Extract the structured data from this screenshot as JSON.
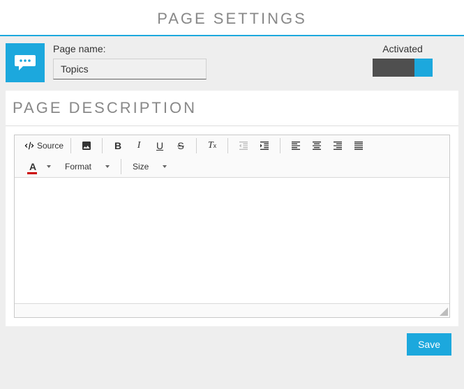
{
  "header": {
    "title": "PAGE SETTINGS"
  },
  "settings": {
    "page_name_label": "Page name:",
    "page_name_value": "Topics",
    "activated_label": "Activated",
    "activated": true
  },
  "description": {
    "title": "PAGE DESCRIPTION",
    "content": ""
  },
  "editor_toolbar": {
    "source": "Source",
    "text_color_letter": "A",
    "format_label": "Format",
    "size_label": "Size"
  },
  "actions": {
    "save": "Save"
  },
  "colors": {
    "accent": "#1ca8dd"
  }
}
